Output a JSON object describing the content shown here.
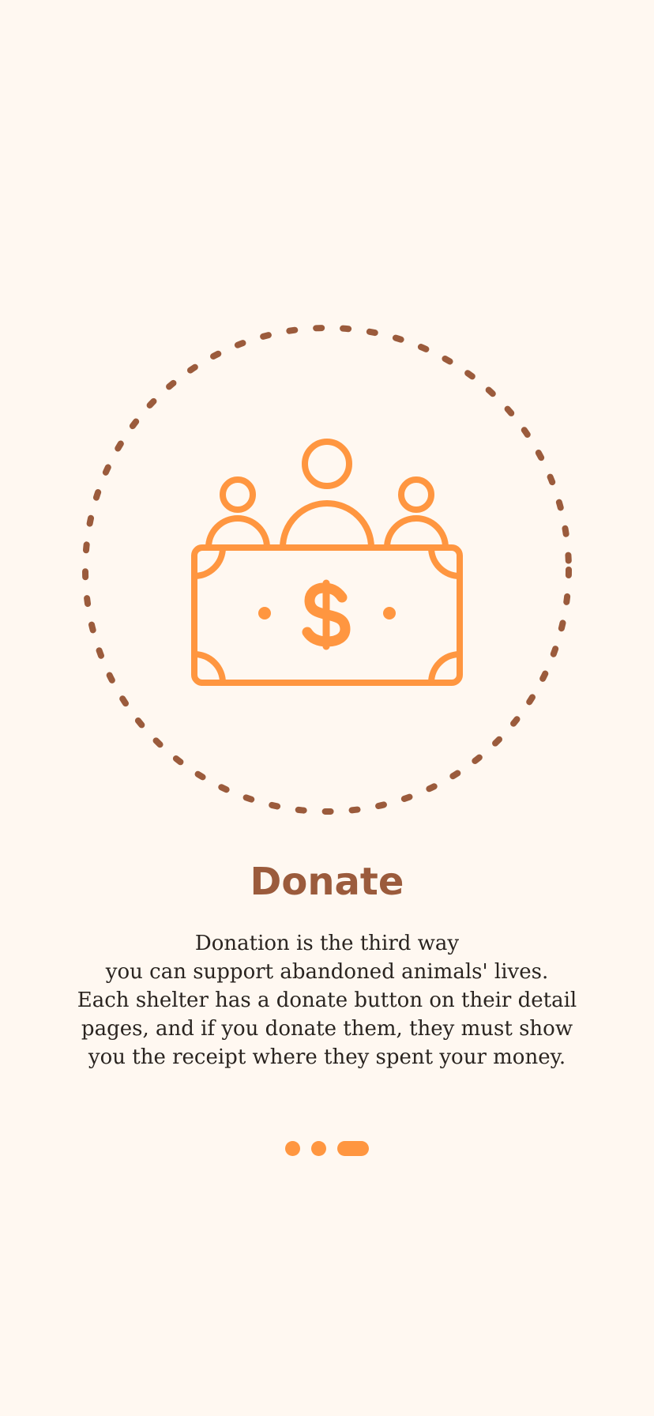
{
  "onboarding": {
    "illustration": {
      "icon": "people-donating-money-icon",
      "accent_color": "#FF9640",
      "ring_color": "#9B5B3C"
    },
    "title": "Donate",
    "description_lines": [
      "Donation is the third way",
      "you can support abandoned animals' lives.",
      "Each shelter has a donate button on their detail",
      "pages, and if you donate them, they must show",
      "you the receipt where they spent your money."
    ],
    "pager": {
      "total_pages": 3,
      "current_page": 3
    }
  },
  "colors": {
    "background": "#FFF8F1",
    "title": "#9B5B3C",
    "text": "#2A2420",
    "accent": "#FF9640"
  }
}
